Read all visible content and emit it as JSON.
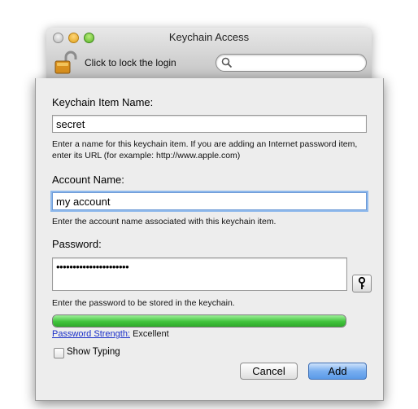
{
  "window": {
    "title": "Keychain Access",
    "lock_label": "Click to lock the login",
    "search_placeholder": ""
  },
  "sheet": {
    "item_name": {
      "label": "Keychain Item Name:",
      "value": "secret",
      "hint": "Enter a name for this keychain item. If you are adding an Internet password item, enter its URL (for example: http://www.apple.com)"
    },
    "account_name": {
      "label": "Account Name:",
      "value": "my account",
      "hint": "Enter the account name associated with this keychain item."
    },
    "password": {
      "label": "Password:",
      "value": "••••••••••••••••••••••",
      "hint": "Enter the password to be stored in the keychain."
    },
    "strength": {
      "link_label": "Password Strength:",
      "value_label": "Excellent",
      "level": 1.0
    },
    "show_typing_label": "Show Typing",
    "cancel_label": "Cancel",
    "add_label": "Add"
  },
  "colors": {
    "accent_blue": "#5b9be8",
    "strength_green": "#41c43c",
    "link_blue": "#1a2fc9"
  }
}
